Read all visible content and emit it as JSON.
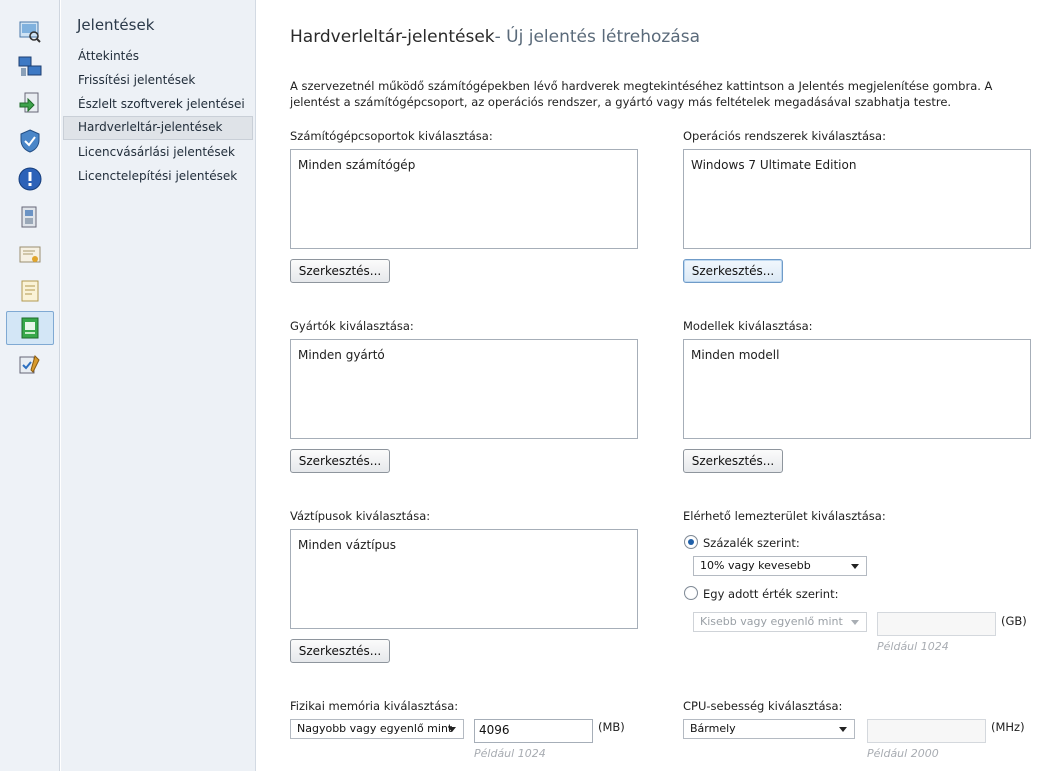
{
  "iconbar": [
    {
      "name": "overview-icon"
    },
    {
      "name": "computers-icon"
    },
    {
      "name": "updates-icon"
    },
    {
      "name": "security-shield-icon"
    },
    {
      "name": "alerts-icon"
    },
    {
      "name": "software-icon"
    },
    {
      "name": "license-icon"
    },
    {
      "name": "reports-document-icon"
    },
    {
      "name": "hardware-inventory-icon",
      "active": true
    },
    {
      "name": "settings-tools-icon"
    }
  ],
  "nav": {
    "title": "Jelentések",
    "items": [
      {
        "label": "Áttekintés"
      },
      {
        "label": "Frissítési jelentések"
      },
      {
        "label": "Észlelt szoftverek jelentései"
      },
      {
        "label": "Hardverleltár-jelentések",
        "active": true
      },
      {
        "label": "Licencvásárlási jelentések"
      },
      {
        "label": "Licenctelepítési jelentések"
      }
    ]
  },
  "page": {
    "title": "Hardverleltár-jelentések",
    "subtitle": "- Új jelentés létrehozása",
    "description": "A szervezetnél működő számítógépekben lévő hardverek megtekintéséhez kattintson a Jelentés megjelenítése gombra. A jelentést a számítógépcsoport, az operációs rendszer, a gyártó vagy más feltételek megadásával szabhatja testre."
  },
  "sections": {
    "computer_groups": {
      "label": "Számítógépcsoportok kiválasztása:",
      "value": "Minden számítógép",
      "button": "Szerkesztés..."
    },
    "operating_systems": {
      "label": "Operációs rendszerek kiválasztása:",
      "value": "Windows 7 Ultimate Edition",
      "button": "Szerkesztés..."
    },
    "manufacturers": {
      "label": "Gyártók kiválasztása:",
      "value": "Minden gyártó",
      "button": "Szerkesztés..."
    },
    "models": {
      "label": "Modellek kiválasztása:",
      "value": "Minden modell",
      "button": "Szerkesztés..."
    },
    "chassis": {
      "label": "Váztípusok kiválasztása:",
      "value": "Minden váztípus",
      "button": "Szerkesztés..."
    },
    "disk_space": {
      "label": "Elérhető lemezterület kiválasztása:",
      "percent_option": "Százalék szerint:",
      "percent_value": "10% vagy kevesebb",
      "value_option": "Egy adott érték szerint:",
      "comparison": "Kisebb vagy egyenlő mint",
      "amount": "",
      "unit": "(GB)",
      "example": "Például 1024",
      "selected": "percent"
    },
    "memory": {
      "label": "Fizikai memória kiválasztása:",
      "comparison": "Nagyobb vagy egyenlő mint",
      "amount": "4096",
      "unit": "(MB)",
      "example": "Például 1024"
    },
    "cpu": {
      "label": "CPU-sebesség kiválasztása:",
      "comparison": "Bármely",
      "amount": "",
      "unit": "(MHz)",
      "example": "Például 2000"
    }
  }
}
